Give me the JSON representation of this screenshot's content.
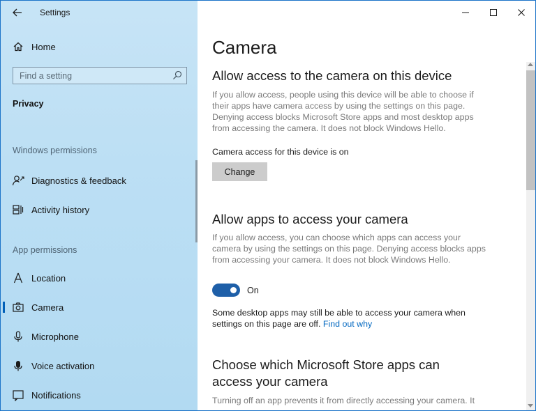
{
  "app": {
    "title": "Settings"
  },
  "sidebar": {
    "home_label": "Home",
    "search_placeholder": "Find a setting",
    "privacy_heading": "Privacy",
    "windows_permissions_heading": "Windows permissions",
    "app_permissions_heading": "App permissions",
    "windows_items": [
      {
        "label": "Diagnostics & feedback",
        "icon": "diagnostics-icon"
      },
      {
        "label": "Activity history",
        "icon": "activity-history-icon"
      }
    ],
    "app_items": [
      {
        "label": "Location",
        "icon": "location-icon"
      },
      {
        "label": "Camera",
        "icon": "camera-icon",
        "active": true
      },
      {
        "label": "Microphone",
        "icon": "microphone-icon"
      },
      {
        "label": "Voice activation",
        "icon": "voice-activation-icon"
      },
      {
        "label": "Notifications",
        "icon": "notifications-icon"
      }
    ]
  },
  "main": {
    "title": "Camera",
    "device_section": {
      "heading": "Allow access to the camera on this device",
      "description": "If you allow access, people using this device will be able to choose if their apps have camera access by using the settings on this page. Denying access blocks Microsoft Store apps and most desktop apps from accessing the camera. It does not block Windows Hello.",
      "status": "Camera access for this device is on",
      "change_button": "Change"
    },
    "apps_section": {
      "heading": "Allow apps to access your camera",
      "description": "If you allow access, you can choose which apps can access your camera by using the settings on this page. Denying access blocks apps from accessing your camera. It does not block Windows Hello.",
      "toggle_state": "On",
      "note": "Some desktop apps may still be able to access your camera when settings on this page are off.",
      "note_link": "Find out why"
    },
    "store_section": {
      "heading": "Choose which Microsoft Store apps can access your camera",
      "description": "Turning off an app prevents it from directly accessing your camera. It"
    }
  },
  "colors": {
    "accent": "#005fb8",
    "toggle_on": "#1e5fa8",
    "link": "#0067c0",
    "sidebar_bg": "#bcdff4"
  }
}
